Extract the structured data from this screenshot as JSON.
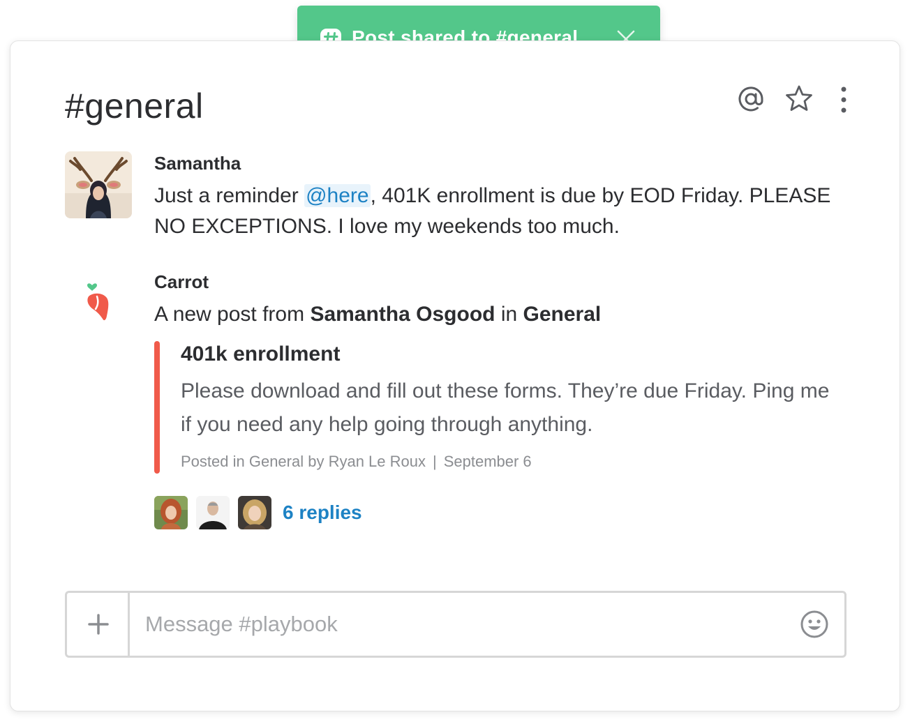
{
  "toast": {
    "text": "Post shared to #general",
    "icon": "slack-hash-icon",
    "color": "#53c78a"
  },
  "channel": {
    "title": "#general",
    "icons": [
      "at-mention-icon",
      "star-icon",
      "more-vertical-icon"
    ]
  },
  "messages": [
    {
      "author": "Samantha",
      "text_before": "Just a reminder ",
      "mention": "@here",
      "text_after": ", 401K enrollment is due by EOD Friday. PLEASE NO EXCEPTIONS. I love my weekends too much."
    },
    {
      "author": "Carrot",
      "intro_prefix": "A new post from ",
      "intro_person": "Samantha Osgood",
      "intro_mid": " in ",
      "intro_place": "General",
      "attachment": {
        "title": "401k enrollment",
        "body": "Please download and fill out these forms. They’re due Friday. Ping me if you need any help going through anything.",
        "meta_posted": "Posted in General by Ryan Le Roux",
        "meta_sep": "|",
        "meta_date": "September 6",
        "accent_color": "#f05a4a"
      },
      "replies": {
        "label": "6 replies"
      }
    }
  ],
  "composer": {
    "placeholder": "Message #playbook",
    "value": ""
  },
  "colors": {
    "link": "#1d82c4",
    "text": "#2c2d30",
    "muted": "#8b8d91"
  }
}
